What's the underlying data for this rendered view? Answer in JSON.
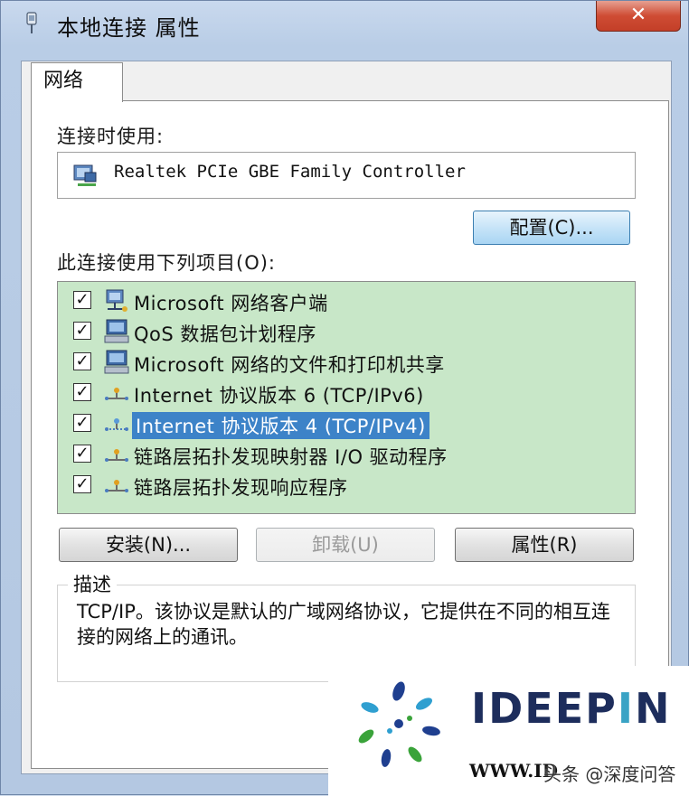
{
  "window": {
    "title": "本地连接 属性",
    "close_label": "✕"
  },
  "tabs": [
    {
      "label": "网络",
      "active": true
    }
  ],
  "connect_using": {
    "label": "连接时使用:",
    "adapter": "Realtek PCIe GBE Family Controller",
    "configure_button": "配置(C)..."
  },
  "items_section": {
    "label": "此连接使用下列项目(O):",
    "items": [
      {
        "label": "Microsoft 网络客户端",
        "checked": true,
        "icon": "network-client-icon",
        "selected": false
      },
      {
        "label": "QoS 数据包计划程序",
        "checked": true,
        "icon": "computer-icon",
        "selected": false
      },
      {
        "label": "Microsoft 网络的文件和打印机共享",
        "checked": true,
        "icon": "computer-icon",
        "selected": false
      },
      {
        "label": "Internet 协议版本 6 (TCP/IPv6)",
        "checked": true,
        "icon": "protocol-icon",
        "selected": false
      },
      {
        "label": "Internet 协议版本 4 (TCP/IPv4)",
        "checked": true,
        "icon": "protocol-icon",
        "selected": true
      },
      {
        "label": "链路层拓扑发现映射器 I/O 驱动程序",
        "checked": true,
        "icon": "protocol-icon",
        "selected": false
      },
      {
        "label": "链路层拓扑发现响应程序",
        "checked": true,
        "icon": "protocol-icon",
        "selected": false
      }
    ],
    "highlight_color": "#c8e7c8",
    "selection_color": "#3d83c8"
  },
  "buttons": {
    "install": "安装(N)...",
    "uninstall": "卸载(U)",
    "properties": "属性(R)"
  },
  "description": {
    "legend": "描述",
    "text": "TCP/IP。该协议是默认的广域网络协议，它提供在不同的相互连接的网络上的通讯。"
  },
  "watermark": {
    "brand_prefix": "IDEEP",
    "brand_accent": "I",
    "brand_suffix": "N",
    "url": "WWW.ID",
    "credit": "头条 @深度问答"
  }
}
